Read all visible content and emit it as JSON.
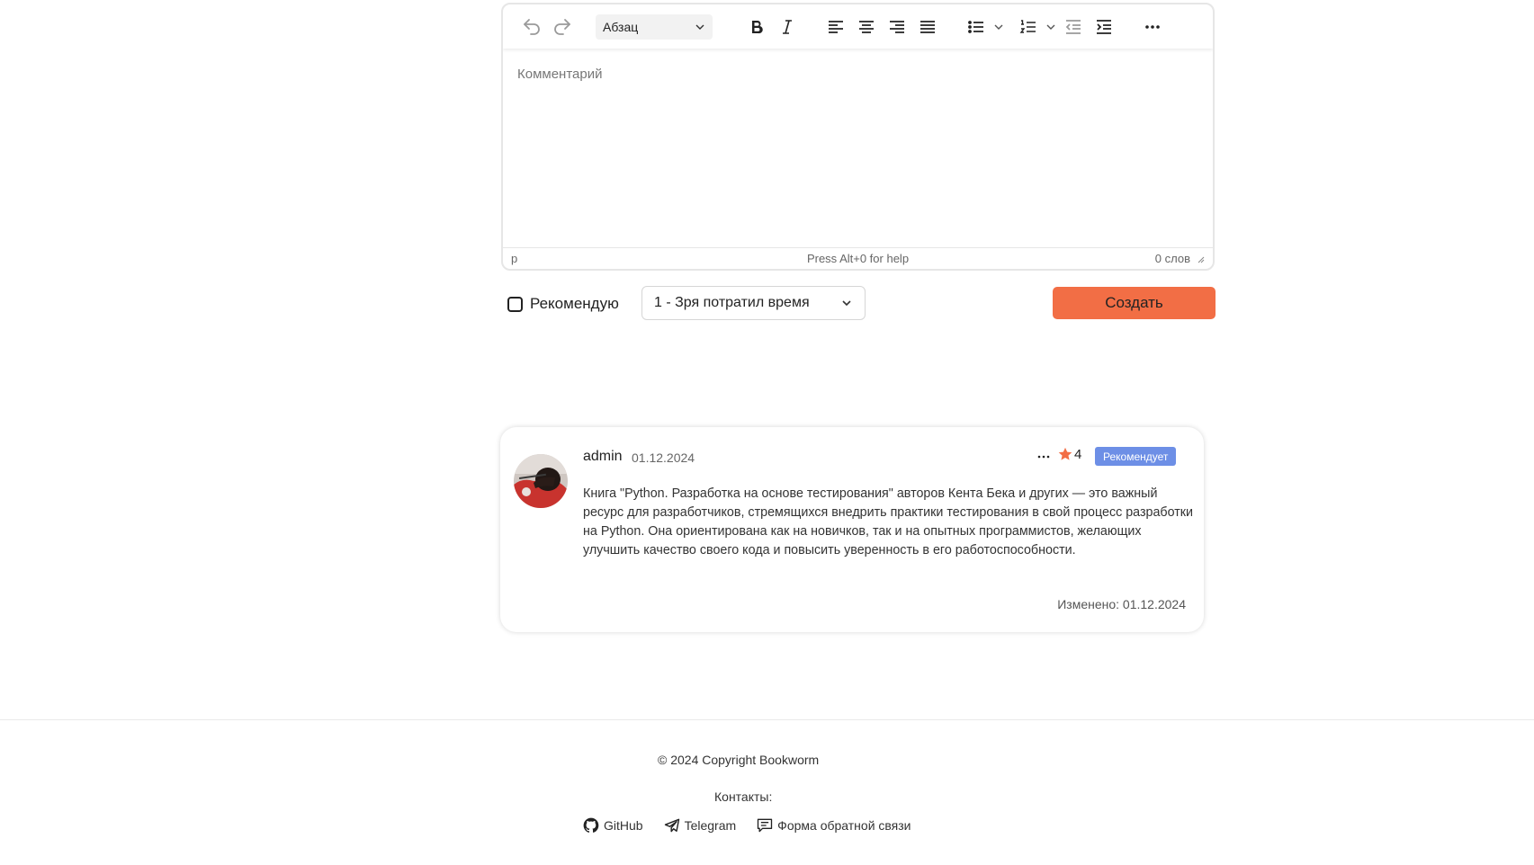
{
  "editor": {
    "format_value": "Абзац",
    "placeholder": "Комментарий",
    "status_path": "p",
    "status_help": "Press Alt+0 for help",
    "word_count": "0 слов",
    "toolbar_icons": [
      "undo-icon",
      "redo-icon",
      "bold-icon",
      "italic-icon",
      "align-left-icon",
      "align-center-icon",
      "align-right-icon",
      "align-justify-icon",
      "bullet-list-icon",
      "numbered-list-icon",
      "outdent-icon",
      "indent-icon",
      "more-icon"
    ]
  },
  "form": {
    "recommend_label": "Рекомендую",
    "recommend_checked": false,
    "rating_value": "1 - Зря потратил время",
    "submit_label": "Создать",
    "accent_color": "#f26e45"
  },
  "comment": {
    "author": "admin",
    "date": "01.12.2024",
    "rating": "4",
    "badge": "Рекомендует",
    "badge_color": "#6d8fe6",
    "text": "Книга \"Python. Разработка на основе тестирования\" авторов Кента Бека и других — это важный ресурс для разработчиков, стремящихся внедрить практики тестирования в свой процесс разработки на Python. Она ориентирована как на новичков, так и на опытных программистов, желающих улучшить качество своего кода и повысить уверенность в его работоспособности.",
    "edited": "Изменено: 01.12.2024"
  },
  "footer": {
    "copyright": "© 2024 Copyright Bookworm",
    "contacts_label": "Контакты:",
    "links": [
      {
        "label": "GitHub",
        "icon": "github-icon"
      },
      {
        "label": "Telegram",
        "icon": "telegram-icon"
      },
      {
        "label": "Форма обратной связи",
        "icon": "feedback-icon"
      }
    ]
  }
}
